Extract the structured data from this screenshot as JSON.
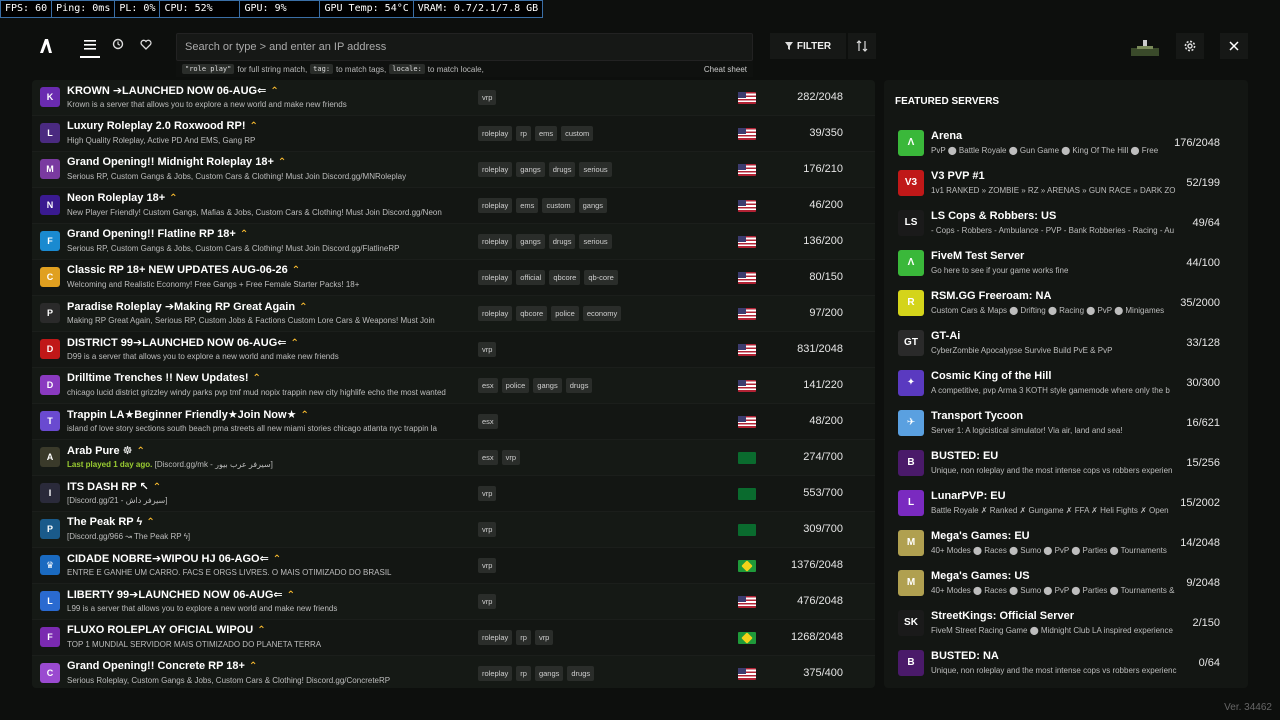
{
  "stats": [
    "FPS: 60",
    "Ping: 0ms",
    "PL: 0%",
    "CPU: 52%",
    "GPU: 9%",
    "GPU Temp: 54°C",
    "VRAM: 0.7/2.1/7.8 GB"
  ],
  "header": {
    "search_placeholder": "Search or type > and enter an IP address",
    "hint_kbd1": "\"role play\"",
    "hint_text1": "for full string match,",
    "hint_kbd2": "tag:",
    "hint_text2": "to match tags,",
    "hint_kbd3": "locale:",
    "hint_text3": "to match locale,",
    "cheat_sheet": "Cheat sheet",
    "filter_label": "FILTER"
  },
  "servers": [
    {
      "name": "KROWN ➔LAUNCHED NOW 06-AUG⇐",
      "desc": "Krown is a server that allows you to explore a new world and make new friends",
      "tags": [
        "vrp"
      ],
      "flag": "us",
      "players": "282/2048",
      "color": "#6a2bb0",
      "icon": "K"
    },
    {
      "name": "Luxury Roleplay 2.0 Roxwood RP!",
      "desc": "High Quality Roleplay, Active PD And EMS, Gang RP",
      "tags": [
        "roleplay",
        "rp",
        "ems",
        "custom"
      ],
      "flag": "us",
      "players": "39/350",
      "color": "#4a2a80",
      "icon": "L"
    },
    {
      "name": "Grand Opening!! Midnight Roleplay 18+",
      "desc": "Serious RP, Custom Gangs & Jobs, Custom Cars & Clothing! Must Join Discord.gg/MNRoleplay",
      "tags": [
        "roleplay",
        "gangs",
        "drugs",
        "serious"
      ],
      "flag": "us",
      "players": "176/210",
      "color": "#7a3aa0",
      "icon": "M"
    },
    {
      "name": "Neon Roleplay 18+",
      "desc": "New Player Friendly! Custom Gangs, Mafias & Jobs, Custom Cars & Clothing! Must Join Discord.gg/Neon",
      "tags": [
        "roleplay",
        "ems",
        "custom",
        "gangs"
      ],
      "flag": "us",
      "players": "46/200",
      "color": "#3a1a90",
      "icon": "N"
    },
    {
      "name": "Grand Opening!! Flatline RP 18+",
      "desc": "Serious RP, Custom Gangs & Jobs, Custom Cars & Clothing! Must Join Discord.gg/FlatlineRP",
      "tags": [
        "roleplay",
        "gangs",
        "drugs",
        "serious"
      ],
      "flag": "us",
      "players": "136/200",
      "color": "#1a8ad0",
      "icon": "F"
    },
    {
      "name": "Classic RP 18+ NEW UPDATES AUG-06-26",
      "desc": "Welcoming and Realistic Economy! Free Gangs + Free Female Starter Packs! 18+",
      "tags": [
        "roleplay",
        "official",
        "qbcore",
        "qb-core"
      ],
      "flag": "us",
      "players": "80/150",
      "color": "#e0a020",
      "icon": "C"
    },
    {
      "name": "Paradise Roleplay ➔Making RP Great Again",
      "desc": "Making RP Great Again, Serious RP, Custom Jobs & Factions Custom Lore Cars & Weapons! Must Join",
      "tags": [
        "roleplay",
        "qbcore",
        "police",
        "economy"
      ],
      "flag": "us",
      "players": "97/200",
      "color": "#2a2a2a",
      "icon": "P"
    },
    {
      "name": "DISTRICT 99➔LAUNCHED NOW 06-AUG⇐",
      "desc": "D99 is a server that allows you to explore a new world and make new friends",
      "tags": [
        "vrp"
      ],
      "flag": "us",
      "players": "831/2048",
      "color": "#c01818",
      "icon": "D"
    },
    {
      "name": "Drilltime Trenches !! New Updates!",
      "desc": "chicago lucid district grizzley windy parks pvp tmf mud nopix trappin new city highlife echo the most wanted",
      "tags": [
        "esx",
        "police",
        "gangs",
        "drugs"
      ],
      "flag": "us",
      "players": "141/220",
      "color": "#8a3ac0",
      "icon": "D"
    },
    {
      "name": "Trappin LA★Beginner Friendly★Join Now★",
      "desc": "island of love story sections south beach pma streets all new miami stories chicago atlanta nyc trappin la",
      "tags": [
        "esx"
      ],
      "flag": "us",
      "players": "48/200",
      "color": "#6a4ad0",
      "icon": "T"
    },
    {
      "name": "Arab Pure ☸",
      "lastplayed": "Last played 1 day ago.",
      "desc": "[Discord.gg/mk - سيرفر عرب بيور]",
      "tags": [
        "esx",
        "vrp"
      ],
      "flag": "sa",
      "players": "274/700",
      "color": "#3a3a2a",
      "icon": "A"
    },
    {
      "name": "ITS DASH RP ↖",
      "desc": "[Discord.gg/21 - سيرفر داش]",
      "tags": [
        "vrp"
      ],
      "flag": "sa",
      "players": "553/700",
      "color": "#2a2a3a",
      "icon": "I"
    },
    {
      "name": "The Peak RP ϟ",
      "desc": "[Discord.gg/966 ↝ The Peak RP ϟ]",
      "tags": [
        "vrp"
      ],
      "flag": "sa",
      "players": "309/700",
      "color": "#1a5a8a",
      "icon": "P"
    },
    {
      "name": "CIDADE NOBRE➔WIPOU HJ 06-AGO⇐",
      "desc": "ENTRE E GANHE UM CARRO. FACS E ORGS LIVRES. O MAIS OTIMIZADO DO BRASIL",
      "tags": [
        "vrp"
      ],
      "flag": "br",
      "players": "1376/2048",
      "color": "#1a6ac0",
      "icon": "♛"
    },
    {
      "name": "LIBERTY 99➔LAUNCHED NOW 06-AUG⇐",
      "desc": "L99 is a server that allows you to explore a new world and make new friends",
      "tags": [
        "vrp"
      ],
      "flag": "us",
      "players": "476/2048",
      "color": "#2a6ad0",
      "icon": "L"
    },
    {
      "name": "FLUXO ROLEPLAY OFICIAL WIPOU",
      "desc": "TOP 1 MUNDIAL SERVIDOR MAIS OTIMIZADO DO PLANETA TERRA",
      "tags": [
        "roleplay",
        "rp",
        "vrp"
      ],
      "flag": "br",
      "players": "1268/2048",
      "color": "#7a2ab0",
      "icon": "F"
    },
    {
      "name": "Grand Opening!! Concrete RP 18+",
      "desc": "Serious Roleplay, Custom Gangs & Jobs, Custom Cars & Clothing! Discord.gg/ConcreteRP",
      "tags": [
        "roleplay",
        "rp",
        "gangs",
        "drugs"
      ],
      "flag": "us",
      "players": "375/400",
      "color": "#9a4ad0",
      "icon": "C"
    }
  ],
  "featured": {
    "title": "FEATURED SERVERS",
    "items": [
      {
        "name": "Arena",
        "desc": "PvP ⬤ Battle Royale ⬤ Gun Game ⬤ King Of The Hill ⬤ Free",
        "players": "176/2048",
        "color": "#3ab83a",
        "icon": "Λ"
      },
      {
        "name": "V3 PVP #1",
        "desc": "1v1 RANKED » ZOMBIE » RZ » ARENAS » GUN RACE » DARK ZO",
        "players": "52/199",
        "color": "#c01818",
        "icon": "V3"
      },
      {
        "name": "LS Cops & Robbers: US",
        "desc": "- Cops - Robbers - Ambulance - PVP - Bank Robberies - Racing - Au",
        "players": "49/64",
        "color": "#1a1a1a",
        "icon": "LS"
      },
      {
        "name": "FiveM Test Server",
        "desc": "Go here to see if your game works fine",
        "players": "44/100",
        "color": "#3ab83a",
        "icon": "Λ"
      },
      {
        "name": "RSM.GG Freeroam: NA",
        "desc": "Custom Cars & Maps ⬤ Drifting ⬤ Racing ⬤ PvP ⬤ Minigames",
        "players": "35/2000",
        "color": "#d4d41a",
        "icon": "R"
      },
      {
        "name": "GT-Ai",
        "desc": "CyberZombie Apocalypse Survive Build PvE & PvP",
        "players": "33/128",
        "color": "#2a2a2a",
        "icon": "GT"
      },
      {
        "name": "Cosmic King of the Hill",
        "desc": "A competitive, pvp Arma 3 KOTH style gamemode where only the b",
        "players": "30/300",
        "color": "#5a3ac0",
        "icon": "✦"
      },
      {
        "name": "Transport Tycoon",
        "desc": "Server 1: A logicistical simulator! Via air, land and sea!",
        "players": "16/621",
        "color": "#5aa0e0",
        "icon": "✈"
      },
      {
        "name": "BUSTED: EU",
        "desc": "Unique, non roleplay and the most intense cops vs robbers experien",
        "players": "15/256",
        "color": "#4a1a6a",
        "icon": "B"
      },
      {
        "name": "LunarPVP: EU",
        "desc": "Battle Royale ✗ Ranked ✗ Gungame ✗ FFA ✗ Heli Fights ✗ Open",
        "players": "15/2002",
        "color": "#7a2ac0",
        "icon": "L"
      },
      {
        "name": "Mega's Games: EU",
        "desc": "40+ Modes ⬤ Races ⬤ Sumo ⬤ PvP ⬤ Parties ⬤ Tournaments",
        "players": "14/2048",
        "color": "#b0a050",
        "icon": "M"
      },
      {
        "name": "Mega's Games: US",
        "desc": "40+ Modes ⬤ Races ⬤ Sumo ⬤ PvP ⬤ Parties ⬤ Tournaments &",
        "players": "9/2048",
        "color": "#b0a050",
        "icon": "M"
      },
      {
        "name": "StreetKings: Official Server",
        "desc": "FiveM Street Racing Game ⬤ Midnight Club LA inspired experience",
        "players": "2/150",
        "color": "#1a1a1a",
        "icon": "SK"
      },
      {
        "name": "BUSTED: NA",
        "desc": "Unique, non roleplay and the most intense cops vs robbers experienc",
        "players": "0/64",
        "color": "#4a1a6a",
        "icon": "B"
      }
    ]
  },
  "version": "Ver. 34462"
}
